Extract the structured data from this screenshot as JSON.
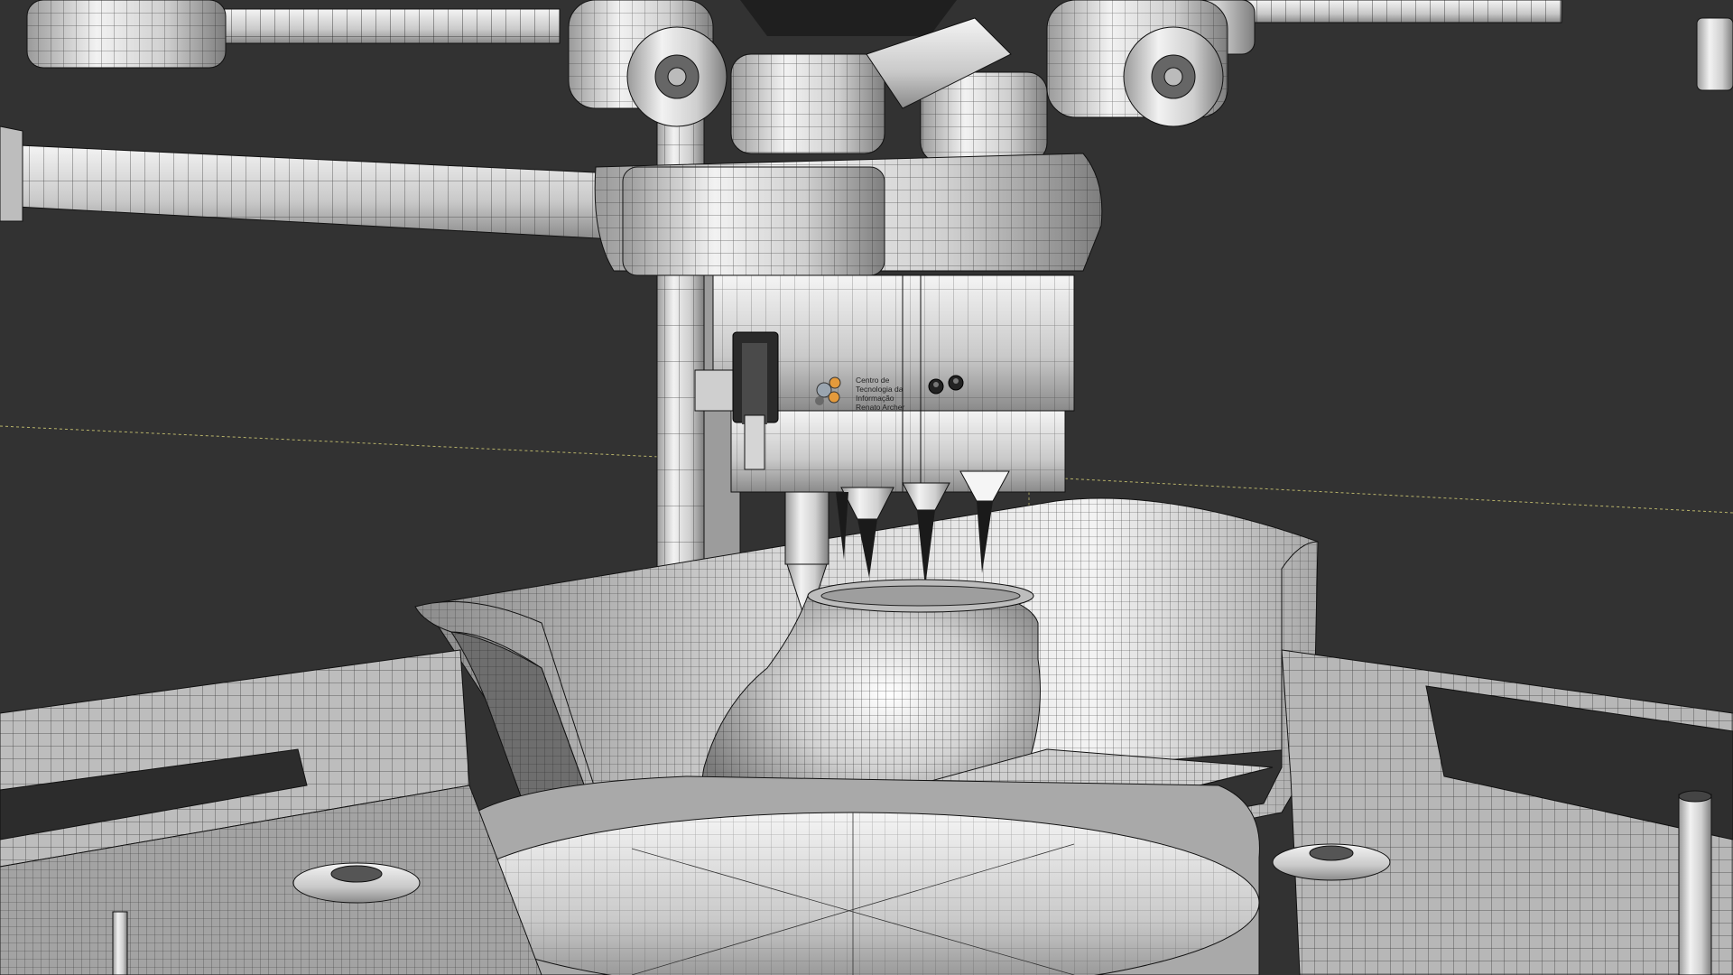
{
  "viewport": {
    "background": "#323232",
    "wireframe_color": "#1a1a1a",
    "surface_light": "#e8e8e8",
    "surface_mid": "#b9b9b9",
    "surface_dark": "#7a7a7a",
    "guide_line_color": "#b8b36a"
  },
  "scene": {
    "subject": "3D wireframe model of a bioprinter printing an ear-shaped object into a tray",
    "logo": {
      "lines": [
        "Centro de",
        "Tecnologia da",
        "Informação",
        "Renato Archer"
      ],
      "accent_color": "#e49a3c",
      "icon": "cti-logo-icon"
    },
    "nozzle_count": 4
  }
}
